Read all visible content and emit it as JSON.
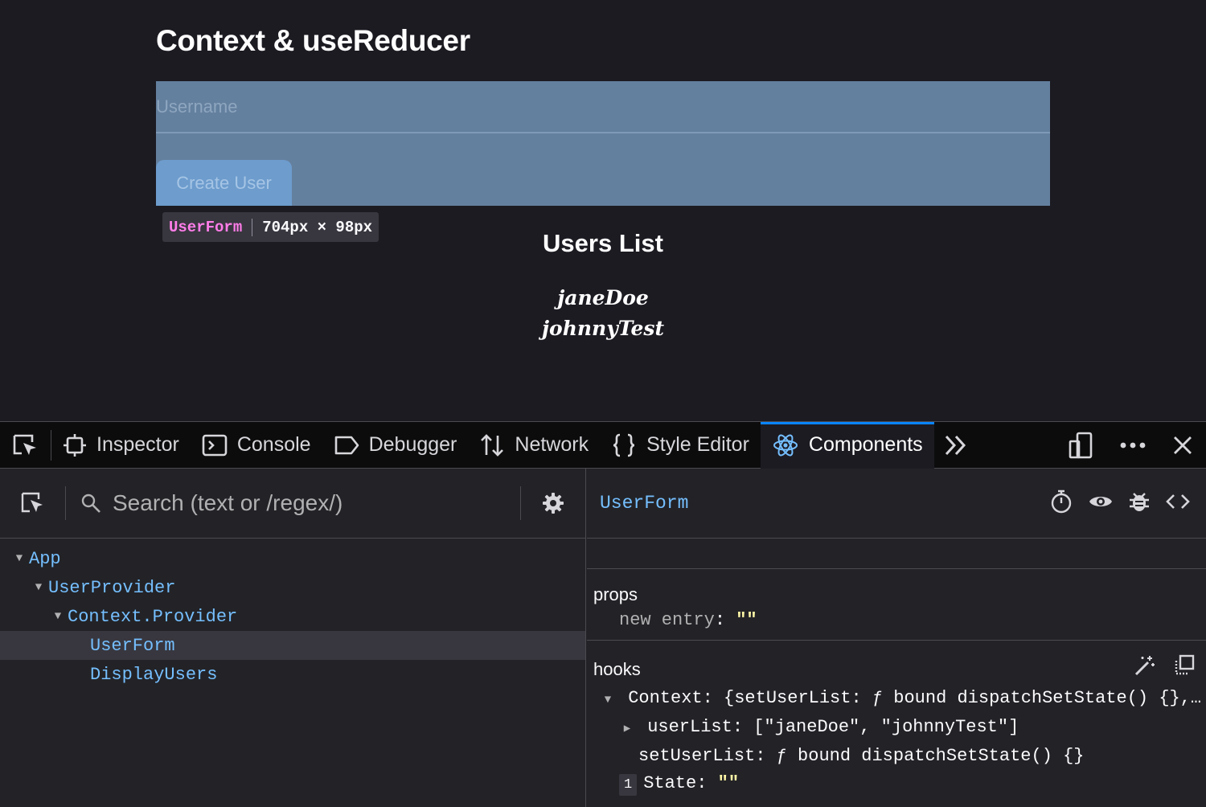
{
  "page": {
    "title": "Context & useReducer",
    "username_placeholder": "Username",
    "username_value": "",
    "create_button": "Create User",
    "highlight_tooltip": {
      "component": "UserForm",
      "dimensions": "704px × 98px"
    },
    "users_title": "Users List",
    "users": [
      "janeDoe",
      "johnnyTest"
    ]
  },
  "devtools": {
    "tabs": [
      {
        "label": "Inspector",
        "icon": "inspector-icon"
      },
      {
        "label": "Console",
        "icon": "console-icon"
      },
      {
        "label": "Debugger",
        "icon": "debugger-icon"
      },
      {
        "label": "Network",
        "icon": "network-icon"
      },
      {
        "label": "Style Editor",
        "icon": "style-editor-icon"
      },
      {
        "label": "Components",
        "icon": "react-icon",
        "active": true
      }
    ],
    "colors": {
      "accent": "#0a84ff",
      "component": "#75bfff",
      "string": "#fff7a6",
      "tooltip_name": "#ff7de9"
    },
    "search_placeholder": "Search (text or /regex/)",
    "tree": [
      {
        "label": "App",
        "depth": 0,
        "expanded": true
      },
      {
        "label": "UserProvider",
        "depth": 1,
        "expanded": true
      },
      {
        "label": "Context.Provider",
        "depth": 2,
        "expanded": true
      },
      {
        "label": "UserForm",
        "depth": 3,
        "selected": true
      },
      {
        "label": "DisplayUsers",
        "depth": 3
      }
    ],
    "selected_component": "UserForm",
    "props": {
      "label": "props",
      "entries": [
        {
          "key": "new entry",
          "value": "\"\""
        }
      ]
    },
    "hooks": {
      "label": "hooks",
      "context": {
        "key": "Context",
        "summary": "{setUserList: ƒ bound dispatchSetState() {},…"
      },
      "userList": {
        "key": "userList",
        "value": "[\"janeDoe\", \"johnnyTest\"]"
      },
      "setUserList": {
        "key": "setUserList",
        "value": "ƒ bound dispatchSetState() {}"
      },
      "state": {
        "index": "1",
        "key": "State",
        "value": "\"\""
      }
    }
  }
}
